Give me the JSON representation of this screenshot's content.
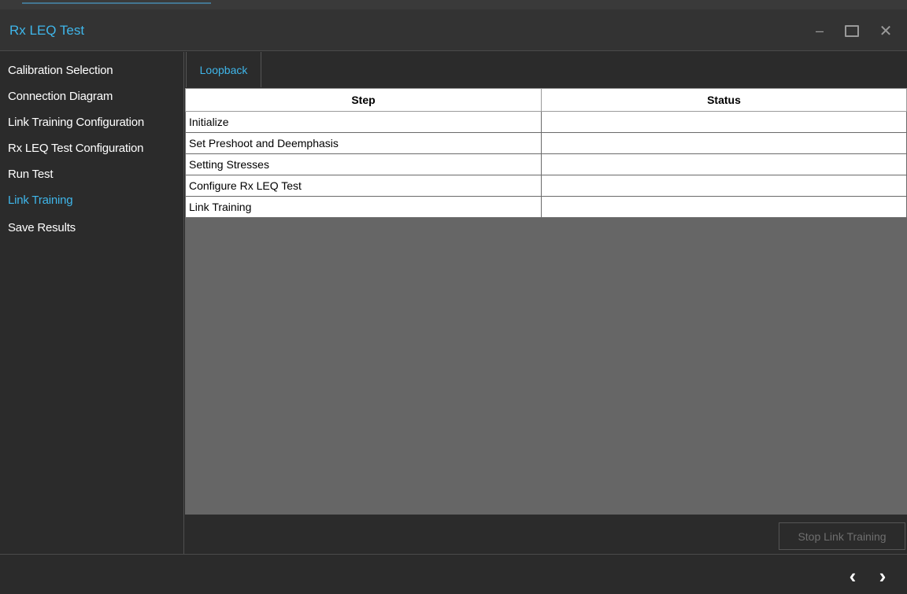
{
  "window": {
    "title": "Rx LEQ Test",
    "controls": {
      "minimize_icon": "–",
      "maximize_icon": "maximize-icon",
      "close_icon": "✕"
    }
  },
  "sidebar": {
    "items": [
      {
        "label": "Calibration Selection",
        "active": false
      },
      {
        "label": "Connection Diagram",
        "active": false
      },
      {
        "label": "Link Training Configuration",
        "active": false
      },
      {
        "label": "Rx LEQ Test Configuration",
        "active": false
      },
      {
        "label": "Run Test",
        "active": false
      },
      {
        "label": "Link Training",
        "active": true
      },
      {
        "label": "Save Results",
        "active": false
      }
    ]
  },
  "main": {
    "tabs": [
      {
        "label": "Loopback"
      }
    ],
    "table": {
      "headers": [
        "Step",
        "Status"
      ],
      "rows": [
        {
          "step": "Initialize",
          "status": ""
        },
        {
          "step": "Set Preshoot and Deemphasis",
          "status": ""
        },
        {
          "step": "Setting Stresses",
          "status": ""
        },
        {
          "step": "Configure Rx LEQ Test",
          "status": ""
        },
        {
          "step": "Link Training",
          "status": ""
        }
      ]
    },
    "stop_button_label": "Stop Link Training"
  },
  "footer": {
    "prev_icon": "‹",
    "next_icon": "›"
  },
  "colors": {
    "accent": "#3fb6ea",
    "background": "#2b2b2b",
    "content_area": "#666666"
  }
}
